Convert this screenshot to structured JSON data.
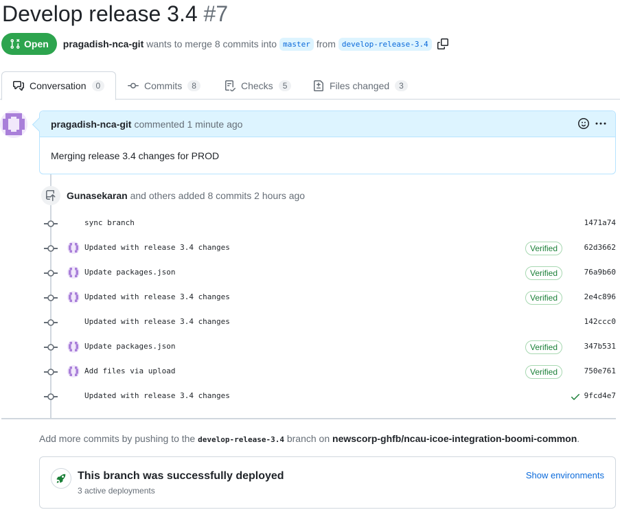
{
  "pr": {
    "title": "Develop release 3.4",
    "number": "#7",
    "state": "Open",
    "author": "pragadish-nca-git",
    "merge_text": "wants to merge 8 commits into",
    "base_branch": "master",
    "from_text": "from",
    "head_branch": "develop-release-3.4"
  },
  "tabs": [
    {
      "label": "Conversation",
      "count": "0",
      "icon": "comment-discussion-icon"
    },
    {
      "label": "Commits",
      "count": "8",
      "icon": "git-commit-icon"
    },
    {
      "label": "Checks",
      "count": "5",
      "icon": "checklist-icon"
    },
    {
      "label": "Files changed",
      "count": "3",
      "icon": "file-diff-icon"
    }
  ],
  "comment": {
    "author": "pragadish-nca-git",
    "action": "commented 1 minute ago",
    "body": "Merging release 3.4 changes for PROD"
  },
  "timeline": {
    "author": "Gunasekaran",
    "text": "and others added 8 commits 2 hours ago"
  },
  "commits": [
    {
      "message": "sync branch",
      "sha": "1471a74",
      "avatar": false,
      "verified": "",
      "check": false
    },
    {
      "message": "Updated with release 3.4 changes",
      "sha": "62d3662",
      "avatar": true,
      "verified": "Verified",
      "check": false
    },
    {
      "message": "Update packages.json",
      "sha": "76a9b60",
      "avatar": true,
      "verified": "Verified",
      "check": false
    },
    {
      "message": "Updated with release 3.4 changes",
      "sha": "2e4c896",
      "avatar": true,
      "verified": "Verified",
      "check": false
    },
    {
      "message": "Updated with release 3.4 changes",
      "sha": "142ccc0",
      "avatar": false,
      "verified": "",
      "check": false
    },
    {
      "message": "Update packages.json",
      "sha": "347b531",
      "avatar": true,
      "verified": "Verified",
      "check": false
    },
    {
      "message": "Add files via upload",
      "sha": "750e761",
      "avatar": true,
      "verified": "Verified",
      "check": false
    },
    {
      "message": "Updated with release 3.4 changes",
      "sha": "9fcd4e7",
      "avatar": false,
      "verified": "",
      "check": true
    }
  ],
  "push_note": {
    "prefix": "Add more commits by pushing to the",
    "branch": "develop-release-3.4",
    "middle": "branch on",
    "repo": "newscorp-ghfb/ncau-icoe-integration-boomi-common",
    "suffix": "."
  },
  "deploy": {
    "title": "This branch was successfully deployed",
    "subtitle": "3 active deployments",
    "link": "Show environments"
  },
  "colors": {
    "open_green": "#2da44e",
    "link_blue": "#0969da",
    "comment_header_bg": "#ddf4ff",
    "verified_green": "#1a7f37",
    "avatar_purple": "#a97fd9"
  }
}
